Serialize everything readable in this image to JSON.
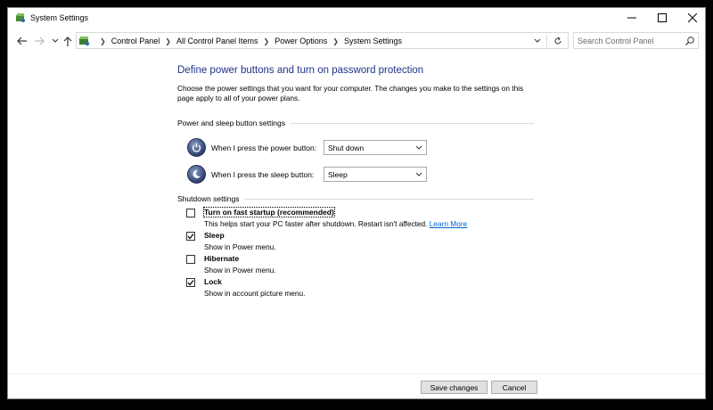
{
  "window": {
    "title": "System Settings"
  },
  "address": {
    "breadcrumbs": [
      "Control Panel",
      "All Control Panel Items",
      "Power Options",
      "System Settings"
    ]
  },
  "search": {
    "placeholder": "Search Control Panel"
  },
  "page": {
    "title": "Define power buttons and turn on password protection",
    "description": "Choose the power settings that you want for your computer. The changes you make to the settings on this page apply to all of your power plans."
  },
  "power_section": {
    "heading": "Power and sleep button settings",
    "power_button": {
      "label": "When I press the power button:",
      "value": "Shut down"
    },
    "sleep_button": {
      "label": "When I press the sleep button:",
      "value": "Sleep"
    }
  },
  "shutdown_section": {
    "heading": "Shutdown settings",
    "options": [
      {
        "label": "Turn on fast startup (recommended)",
        "desc": "This helps start your PC faster after shutdown. Restart isn't affected.",
        "link": "Learn More",
        "checked": false
      },
      {
        "label": "Sleep",
        "desc": "Show in Power menu.",
        "checked": true
      },
      {
        "label": "Hibernate",
        "desc": "Show in Power menu.",
        "checked": false
      },
      {
        "label": "Lock",
        "desc": "Show in account picture menu.",
        "checked": true
      }
    ]
  },
  "footer": {
    "save_label": "Save changes",
    "cancel_label": "Cancel"
  },
  "colors": {
    "title_blue": "#1e3287",
    "link_blue": "#0066cc"
  }
}
